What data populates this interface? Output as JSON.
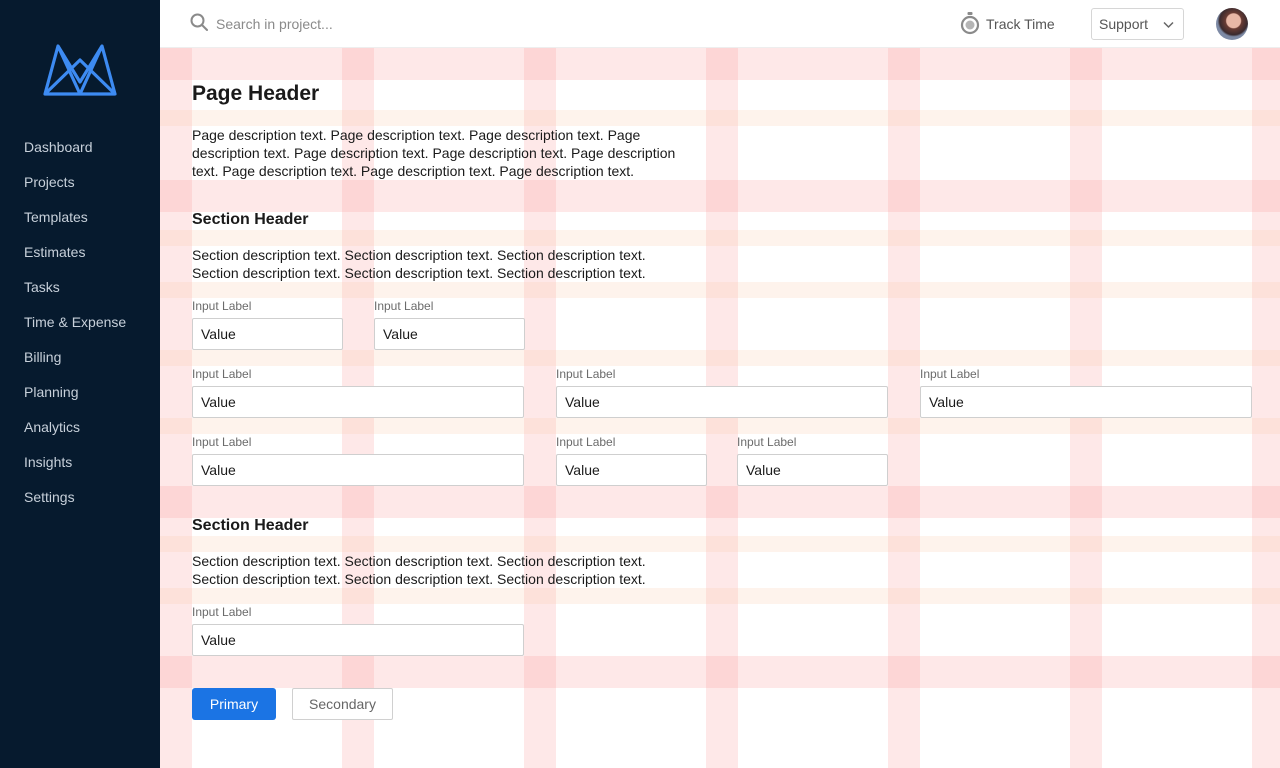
{
  "sidebar": {
    "items": [
      {
        "label": "Dashboard"
      },
      {
        "label": "Projects"
      },
      {
        "label": "Templates"
      },
      {
        "label": "Estimates"
      },
      {
        "label": "Tasks"
      },
      {
        "label": "Time & Expense"
      },
      {
        "label": "Billing"
      },
      {
        "label": "Planning"
      },
      {
        "label": "Analytics"
      },
      {
        "label": "Insights"
      },
      {
        "label": "Settings"
      }
    ]
  },
  "topbar": {
    "search_placeholder": "Search in project...",
    "track_time": "Track Time",
    "support": "Support"
  },
  "page": {
    "title": "Page Header",
    "description": "Page description text. Page description text. Page description text. Page description text. Page description text. Page description text. Page description text. Page description text. Page description text. Page description text."
  },
  "section1": {
    "title": "Section Header",
    "description": "Section description text. Section description text. Section description text. Section description text. Section description text. Section description text.",
    "fields": [
      {
        "label": "Input Label",
        "value": "Value"
      },
      {
        "label": "Input Label",
        "value": "Value"
      },
      {
        "label": "Input Label",
        "value": "Value"
      },
      {
        "label": "Input Label",
        "value": "Value"
      },
      {
        "label": "Input Label",
        "value": "Value"
      },
      {
        "label": "Input Label",
        "value": "Value"
      },
      {
        "label": "Input Label",
        "value": "Value"
      },
      {
        "label": "Input Label",
        "value": "Value"
      }
    ]
  },
  "section2": {
    "title": "Section Header",
    "description": "Section description text. Section description text. Section description text. Section description text. Section description text. Section description text.",
    "fields": [
      {
        "label": "Input Label",
        "value": "Value"
      }
    ]
  },
  "buttons": {
    "primary": "Primary",
    "secondary": "Secondary"
  },
  "colors": {
    "sidebar_bg": "#061a2e",
    "logo_blue": "#3d8bf2",
    "primary_button": "#1b74e4",
    "grid_overlay": "#fa9696"
  }
}
